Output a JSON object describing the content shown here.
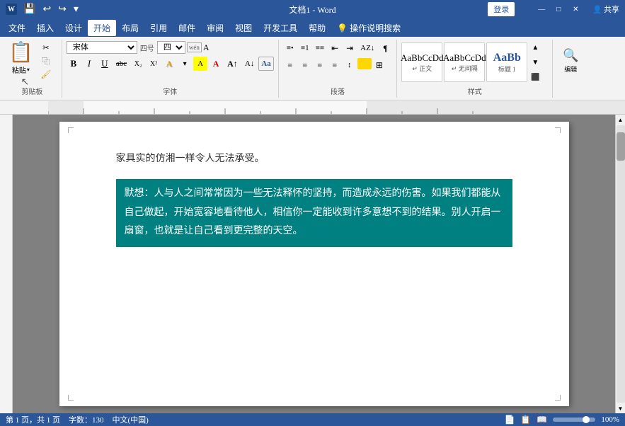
{
  "titlebar": {
    "title": "文档1 - Word",
    "app": "Word",
    "login_label": "登录",
    "share_label": "共享",
    "window_buttons": [
      "—",
      "□",
      "✕"
    ]
  },
  "quickaccess": {
    "save": "💾",
    "undo": "↩",
    "redo": "↪",
    "more": "▾"
  },
  "menubar": {
    "items": [
      "文件",
      "插入",
      "设计",
      "开始",
      "布局",
      "引用",
      "邮件",
      "审阅",
      "视图",
      "开发工具",
      "帮助",
      "💡 操作说明搜索"
    ]
  },
  "ribbon": {
    "groups": {
      "clipboard": {
        "label": "剪贴板"
      },
      "font": {
        "label": "字体",
        "font_name": "宋体",
        "font_size": "四号",
        "size_num": "wén",
        "buttons": [
          "B",
          "I",
          "U",
          "abc",
          "X₂",
          "X²",
          "A"
        ]
      },
      "paragraph": {
        "label": "段落"
      },
      "styles": {
        "label": "样式",
        "items": [
          {
            "name": "正文",
            "preview": "AaBbCcDd"
          },
          {
            "name": "↵ 无间隔",
            "preview": "AaBbCcDd"
          },
          {
            "name": "标题 1",
            "preview": "AaBb"
          }
        ]
      },
      "editing": {
        "label": "编辑",
        "search": "🔍"
      }
    }
  },
  "document": {
    "top_text": "家具实的仿湘一样令人无法承受。",
    "highlighted_text": "默想：人与人之间常常因为一些无法释怀的坚持，而造成永远的伤害。如果我们都能从自己做起，开始宽容地看待他人，相信你一定能收到许多意想不到的结果。别人开启一扇窗，也就是让自己看到更完整的天空。"
  },
  "statusbar": {
    "page_info": "第 1 页，共 1 页",
    "word_count": "字数：130",
    "lang": "中文(中国)",
    "zoom": "100%",
    "view_icons": [
      "📄",
      "📋",
      "📖"
    ]
  }
}
